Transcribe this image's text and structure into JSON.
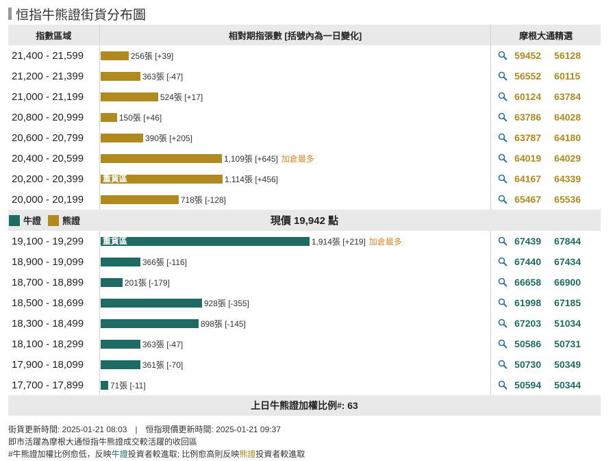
{
  "title": "恒指牛熊證街貨分布圖",
  "header": {
    "col1": "指數區域",
    "col2": "相對期指張數 [括號內為一日變化]",
    "col3": "摩根大通精選"
  },
  "bear_rows": [
    {
      "range": "21,400 - 21,599",
      "value": "256張 [+39]",
      "count": 256,
      "tag": "",
      "most": "",
      "codes": [
        "59452",
        "56128"
      ]
    },
    {
      "range": "21,200 - 21,399",
      "value": "363張 [-47]",
      "count": 363,
      "tag": "",
      "most": "",
      "codes": [
        "56552",
        "60115"
      ]
    },
    {
      "range": "21,000 - 21,199",
      "value": "524張 [+17]",
      "count": 524,
      "tag": "",
      "most": "",
      "codes": [
        "60124",
        "63784"
      ]
    },
    {
      "range": "20,800 - 20,999",
      "value": "150張 [+46]",
      "count": 150,
      "tag": "",
      "most": "",
      "codes": [
        "63786",
        "64028"
      ]
    },
    {
      "range": "20,600 - 20,799",
      "value": "390張 [+205]",
      "count": 390,
      "tag": "",
      "most": "",
      "codes": [
        "63787",
        "64180"
      ]
    },
    {
      "range": "20,400 - 20,599",
      "value": "1,109張 [+645]",
      "count": 1109,
      "tag": "",
      "most": "加倉最多",
      "codes": [
        "64019",
        "64029"
      ]
    },
    {
      "range": "20,200 - 20,399",
      "value": "1,114張 [+456]",
      "count": 1114,
      "tag": "重貨區",
      "most": "",
      "codes": [
        "64167",
        "64339"
      ]
    },
    {
      "range": "20,000 - 20,199",
      "value": "718張 [-128]",
      "count": 718,
      "tag": "",
      "most": "",
      "codes": [
        "65467",
        "65536"
      ]
    }
  ],
  "legend": {
    "bull_label": "牛證",
    "bear_label": "熊證",
    "bull_color": "#1e6b63",
    "bear_color": "#b08a1e"
  },
  "current_price": "現價 19,942 點",
  "bull_rows": [
    {
      "range": "19,100 - 19,299",
      "value": "1,914張 [+219]",
      "count": 1914,
      "tag": "重貨區",
      "most": "加倉最多",
      "codes": [
        "67439",
        "67844"
      ]
    },
    {
      "range": "18,900 - 19,099",
      "value": "366張 [-116]",
      "count": 366,
      "tag": "",
      "most": "",
      "codes": [
        "67440",
        "67434"
      ]
    },
    {
      "range": "18,700 - 18,899",
      "value": "201張 [-179]",
      "count": 201,
      "tag": "",
      "most": "",
      "codes": [
        "66658",
        "66900"
      ]
    },
    {
      "range": "18,500 - 18,699",
      "value": "928張 [-355]",
      "count": 928,
      "tag": "",
      "most": "",
      "codes": [
        "61998",
        "67185"
      ]
    },
    {
      "range": "18,300 - 18,499",
      "value": "898張 [-145]",
      "count": 898,
      "tag": "",
      "most": "",
      "codes": [
        "67203",
        "51034"
      ]
    },
    {
      "range": "18,100 - 18,299",
      "value": "363張 [-47]",
      "count": 363,
      "tag": "",
      "most": "",
      "codes": [
        "50586",
        "50731"
      ]
    },
    {
      "range": "17,900 - 18,099",
      "value": "361張 [-70]",
      "count": 361,
      "tag": "",
      "most": "",
      "codes": [
        "50730",
        "50349"
      ]
    },
    {
      "range": "17,700 - 17,899",
      "value": "71張 [-11]",
      "count": 71,
      "tag": "",
      "most": "",
      "codes": [
        "50594",
        "50344"
      ]
    }
  ],
  "footer": {
    "ratio_label": "上日牛熊證加權比例",
    "ratio_sup": "#",
    "ratio_value": ": 63"
  },
  "notes": {
    "update_line": "街貨更新時間: 2025-01-21 08:03　|　恒指現價更新時間: 2025-01-21 09:37",
    "line2": "即市活躍為摩根大通恒指牛熊證成交較活躍的收回區",
    "line3_a": "#牛熊證加權比例愈低，反映",
    "line3_bull": "牛證",
    "line3_b": "投資者較進取; 比例愈高則反映",
    "line3_bear": "熊證",
    "line3_c": "投資者較進取"
  },
  "icons": {
    "search": "magnifier-icon"
  }
}
